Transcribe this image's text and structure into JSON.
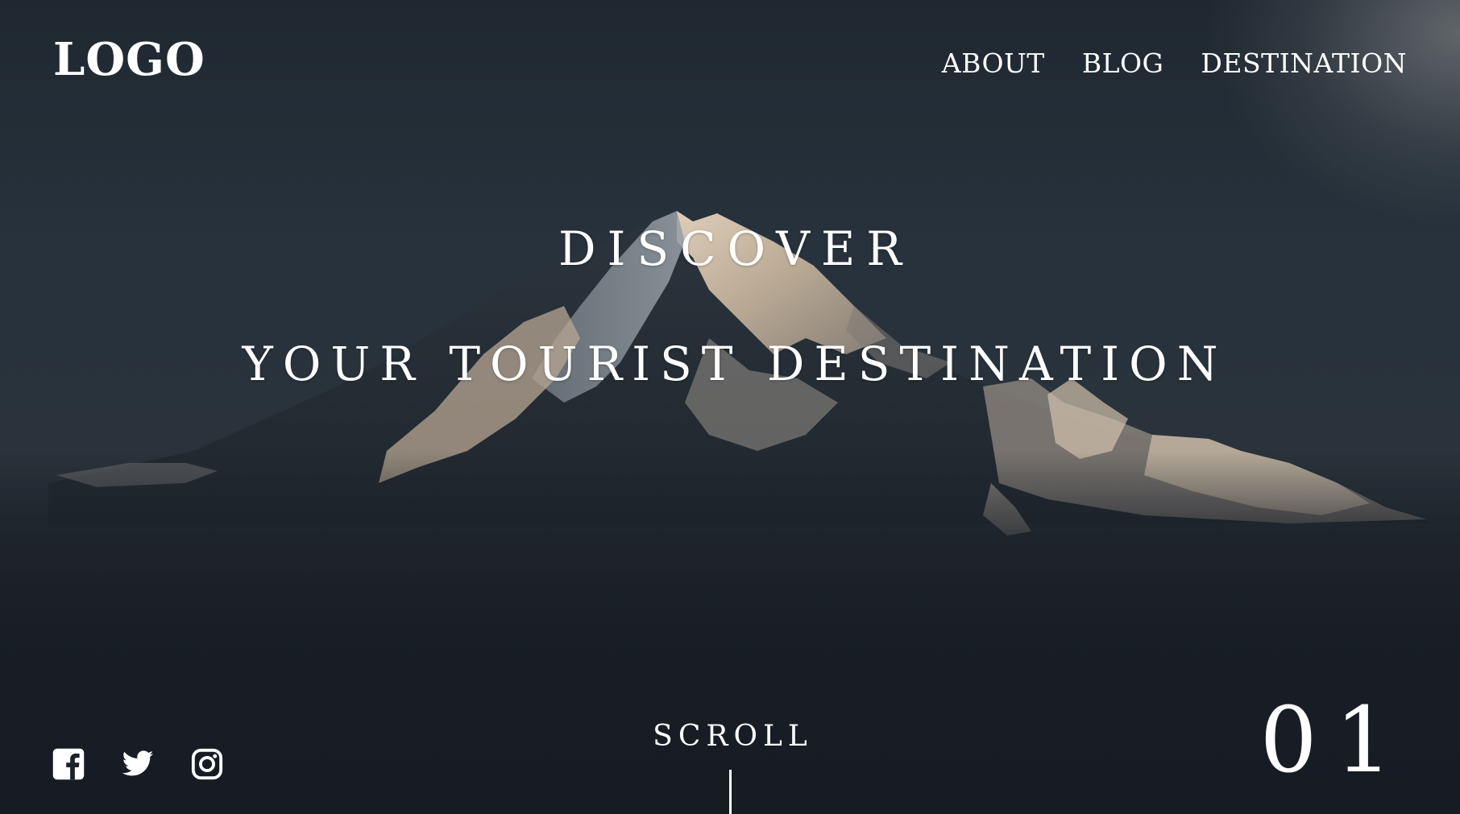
{
  "header": {
    "logo": "LOGO",
    "nav": [
      {
        "label": "ABOUT"
      },
      {
        "label": "BLOG"
      },
      {
        "label": "DESTINATION"
      }
    ]
  },
  "hero": {
    "headline_line1": "DISCOVER",
    "headline_line2": "YOUR TOURIST DESTINATION",
    "background_image": "snow-capped-mountain-peak-at-dusk"
  },
  "footer": {
    "social": [
      {
        "icon": "facebook-icon"
      },
      {
        "icon": "twitter-icon"
      },
      {
        "icon": "instagram-icon"
      }
    ],
    "scroll_label": "SCROLL",
    "slide_number": "01"
  },
  "colors": {
    "text": "#ffffff",
    "background_dark": "#1a212a"
  }
}
